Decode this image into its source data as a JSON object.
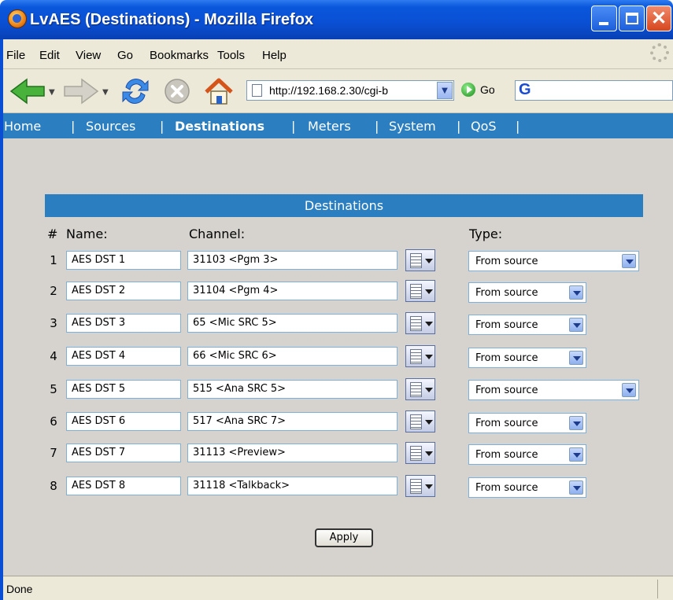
{
  "window": {
    "title": "LvAES (Destinations) - Mozilla Firefox"
  },
  "menubar": {
    "items": [
      "File",
      "Edit",
      "View",
      "Go",
      "Bookmarks",
      "Tools",
      "Help"
    ]
  },
  "navbar": {
    "url": "http://192.168.2.30/cgi-b",
    "go_label": "Go",
    "search_engine_letter": "G"
  },
  "sitenav": {
    "items": [
      "Home",
      "Sources",
      "Destinations",
      "Meters",
      "System",
      "QoS"
    ],
    "active": "Destinations"
  },
  "panel": {
    "title": "Destinations",
    "col_num": "#",
    "col_name": "Name:",
    "col_channel": "Channel:",
    "col_type": "Type:",
    "rows": [
      {
        "num": "1",
        "name": "AES DST 1",
        "channel": "31103 <Pgm 3>",
        "type": "From source"
      },
      {
        "num": "2",
        "name": "AES DST 2",
        "channel": "31104 <Pgm 4>",
        "type": "From source"
      },
      {
        "num": "3",
        "name": "AES DST 3",
        "channel": "65 <Mic SRC 5>",
        "type": "From source"
      },
      {
        "num": "4",
        "name": "AES DST 4",
        "channel": "66 <Mic SRC 6>",
        "type": "From source"
      },
      {
        "num": "5",
        "name": "AES DST 5",
        "channel": "515 <Ana SRC 5>",
        "type": "From source"
      },
      {
        "num": "6",
        "name": "AES DST 6",
        "channel": "517 <Ana SRC 7>",
        "type": "From source"
      },
      {
        "num": "7",
        "name": "AES DST 7",
        "channel": "31113 <Preview>",
        "type": "From source"
      },
      {
        "num": "8",
        "name": "AES DST 8",
        "channel": "31118 <Talkback>",
        "type": "From source"
      }
    ],
    "apply_label": "Apply"
  },
  "status": {
    "text": "Done"
  },
  "colors": {
    "titlebar": "#0a4fd3",
    "nav_strip": "#2b7fc0",
    "content_bg": "#d6d3ce",
    "chrome_bg": "#ece9d8"
  }
}
